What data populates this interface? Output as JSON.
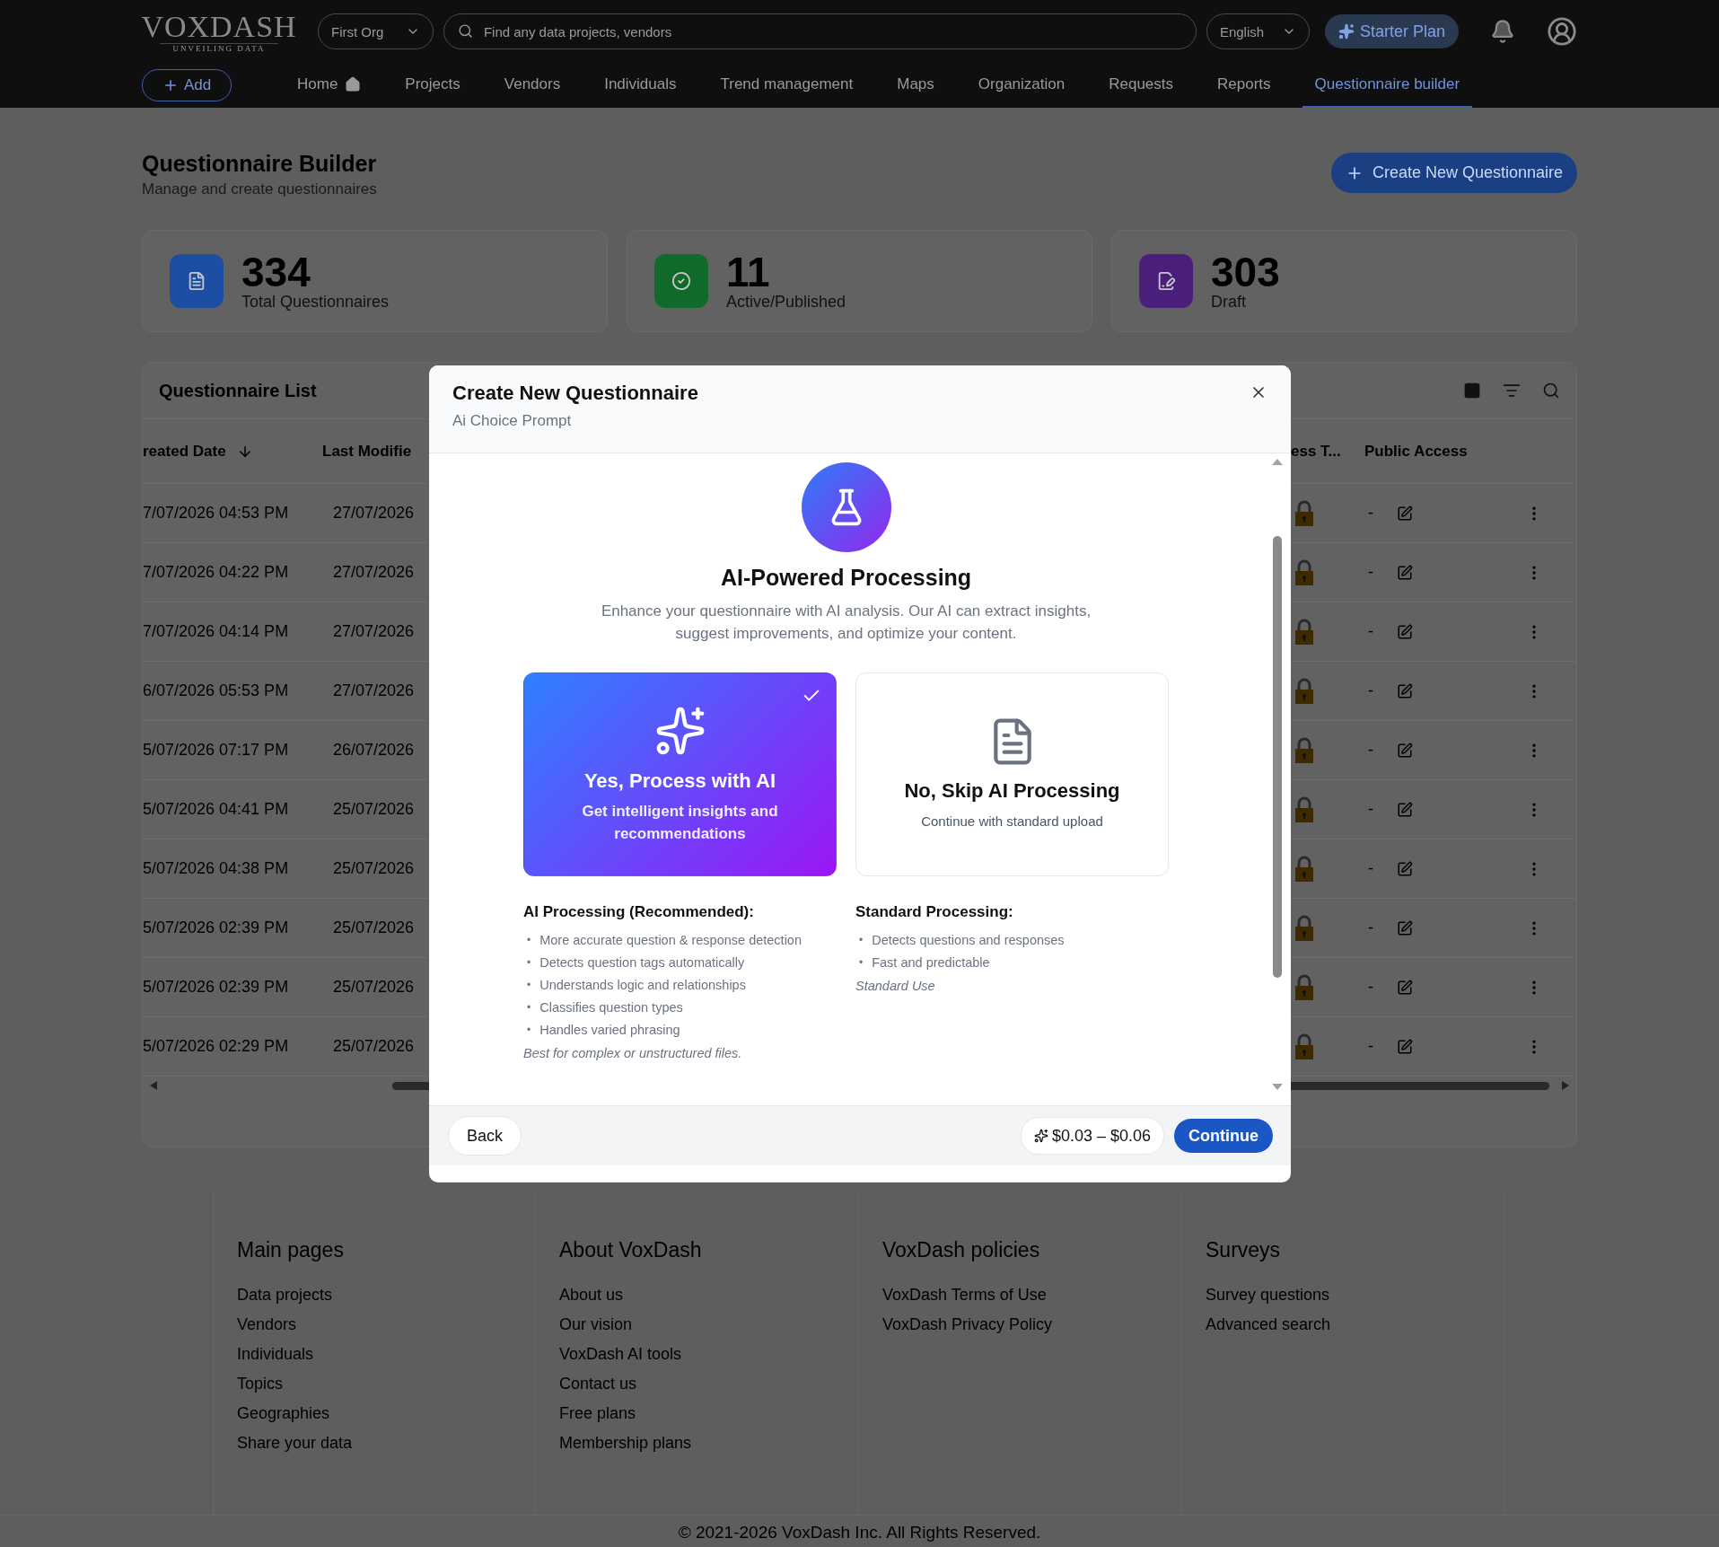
{
  "header": {
    "logo": "VOXDASH",
    "tagline": "UNVEILING DATA",
    "org": "First Org",
    "search": {
      "placeholder": "Find any data projects, vendors"
    },
    "language": "English",
    "plan": "Starter Plan"
  },
  "nav": {
    "add": "Add",
    "items": [
      {
        "label": "Home",
        "kind": "home",
        "selected": false
      },
      {
        "label": "Projects",
        "kind": "text",
        "selected": false
      },
      {
        "label": "Vendors",
        "kind": "text",
        "selected": false
      },
      {
        "label": "Individuals",
        "kind": "text",
        "selected": false
      },
      {
        "label": "Trend management",
        "kind": "text",
        "selected": false
      },
      {
        "label": "Maps",
        "kind": "text",
        "selected": false
      },
      {
        "label": "Organization",
        "kind": "text",
        "selected": false
      },
      {
        "label": "Requests",
        "kind": "text",
        "selected": false
      },
      {
        "label": "Reports",
        "kind": "text",
        "selected": false
      },
      {
        "label": "Questionnaire builder",
        "kind": "text",
        "selected": true
      }
    ]
  },
  "page": {
    "title": "Questionnaire Builder",
    "subtitle": "Manage and create questionnaires",
    "create_button": "Create New Questionnaire"
  },
  "stats": [
    {
      "value": "334",
      "label": "Total Questionnaires",
      "kind": "document",
      "color": "#1c4ea3"
    },
    {
      "value": "11",
      "label": "Active/Published",
      "kind": "check",
      "color": "#0f6a2b"
    },
    {
      "value": "303",
      "label": "Draft",
      "kind": "edit",
      "color": "#4a1f7c"
    }
  ],
  "table": {
    "title": "Questionnaire List",
    "columns": [
      "reated Date",
      "Last Modifie",
      "ess T...",
      "Public Access"
    ],
    "rows": [
      {
        "created": "7/07/2026 04:53 PM",
        "modified": "27/07/2026",
        "public_access": "-"
      },
      {
        "created": "7/07/2026 04:22 PM",
        "modified": "27/07/2026",
        "public_access": "-"
      },
      {
        "created": "7/07/2026 04:14 PM",
        "modified": "27/07/2026",
        "public_access": "-"
      },
      {
        "created": "6/07/2026 05:53 PM",
        "modified": "27/07/2026",
        "public_access": "-"
      },
      {
        "created": "5/07/2026 07:17 PM",
        "modified": "26/07/2026",
        "public_access": "-"
      },
      {
        "created": "5/07/2026 04:41 PM",
        "modified": "25/07/2026",
        "public_access": "-"
      },
      {
        "created": "5/07/2026 04:38 PM",
        "modified": "25/07/2026",
        "public_access": "-"
      },
      {
        "created": "5/07/2026 02:39 PM",
        "modified": "25/07/2026",
        "public_access": "-"
      },
      {
        "created": "5/07/2026 02:39 PM",
        "modified": "25/07/2026",
        "public_access": "-"
      },
      {
        "created": "5/07/2026 02:29 PM",
        "modified": "25/07/2026",
        "public_access": "-"
      }
    ]
  },
  "modal": {
    "title": "Create New Questionnaire",
    "subtitle": "Ai Choice Prompt",
    "heading": "AI-Powered Processing",
    "description": "Enhance your questionnaire with AI analysis. Our AI can extract insights, suggest improvements, and optimize your content.",
    "options": [
      {
        "kind": "ai",
        "title": "Yes, Process with AI",
        "subtitle": "Get intelligent insights and recommendations",
        "selected": true
      },
      {
        "kind": "standard",
        "title": "No, Skip AI Processing",
        "subtitle": "Continue with standard upload",
        "selected": false
      }
    ],
    "details": [
      {
        "heading": "AI Processing (Recommended):",
        "bullet": "•",
        "items": [
          "More accurate question & response detection",
          "Detects question tags automatically",
          "Understands logic and relationships",
          "Classifies question types",
          "Handles varied phrasing"
        ],
        "note": "Best for complex or unstructured files."
      },
      {
        "heading": "Standard Processing:",
        "bullet": "•",
        "items": [
          "Detects questions and responses",
          "Fast and predictable"
        ],
        "note": "Standard Use"
      }
    ],
    "back": "Back",
    "price": "$0.03 – $0.06",
    "continue": "Continue"
  },
  "footer": {
    "columns": [
      {
        "title": "Main pages",
        "links": [
          "Data projects",
          "Vendors",
          "Individuals",
          "Topics",
          "Geographies",
          "Share your data"
        ]
      },
      {
        "title": "About VoxDash",
        "links": [
          "About us",
          "Our vision",
          "VoxDash AI tools",
          "Contact us",
          "Free plans",
          "Membership plans"
        ]
      },
      {
        "title": "VoxDash policies",
        "links": [
          "VoxDash Terms of Use",
          "VoxDash Privacy Policy"
        ]
      },
      {
        "title": "Surveys",
        "links": [
          "Survey questions",
          "Advanced search"
        ]
      }
    ],
    "copyright": "© 2021-2026 VoxDash Inc. All Rights Reserved."
  }
}
